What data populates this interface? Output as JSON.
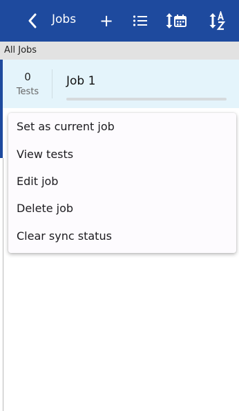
{
  "topbar": {
    "back_icon": "chevron-left-icon",
    "title": "Jobs",
    "add_label": "+",
    "list_icon": "list-icon",
    "sort_date_icon": "sort-by-date-icon",
    "sort_az_icon": "sort-alphabetical-icon",
    "background_color": "#1e4a9e"
  },
  "section_header": {
    "label": "All Jobs"
  },
  "jobs": [
    {
      "tests_count": "0",
      "tests_label": "Tests",
      "name": "Job 1",
      "progress": 0
    }
  ],
  "context_menu": {
    "items": [
      {
        "label": "Set as current job"
      },
      {
        "label": "View tests"
      },
      {
        "label": "Edit job"
      },
      {
        "label": "Delete job"
      },
      {
        "label": "Clear sync status"
      }
    ]
  }
}
